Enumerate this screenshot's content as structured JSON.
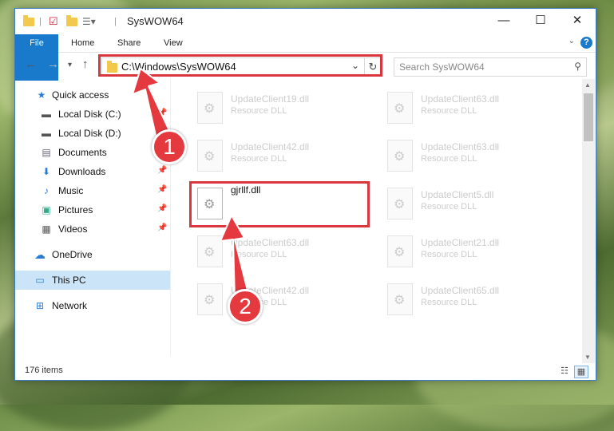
{
  "window": {
    "title": "SysWOW64",
    "controls": {
      "minimize": "—",
      "maximize": "☐",
      "close": "✕"
    }
  },
  "ribbon": {
    "tabs": [
      "File",
      "Home",
      "Share",
      "View"
    ],
    "help": "?"
  },
  "address": {
    "path": "C:\\Windows\\SysWOW64",
    "search_placeholder": "Search SysWOW64"
  },
  "nav_pane": {
    "items": [
      {
        "label": "Quick access",
        "icon": "star-icon"
      },
      {
        "label": "Local Disk (C:)",
        "icon": "drive-icon"
      },
      {
        "label": "Local Disk (D:)",
        "icon": "drive-icon"
      },
      {
        "label": "Documents",
        "icon": "documents-icon"
      },
      {
        "label": "Downloads",
        "icon": "downloads-icon"
      },
      {
        "label": "Music",
        "icon": "music-icon"
      },
      {
        "label": "Pictures",
        "icon": "pictures-icon"
      },
      {
        "label": "Videos",
        "icon": "videos-icon"
      },
      {
        "label": "OneDrive",
        "icon": "cloud-icon"
      },
      {
        "label": "This PC",
        "icon": "computer-icon"
      },
      {
        "label": "Network",
        "icon": "network-icon"
      }
    ]
  },
  "files": [
    {
      "name": "UpdateClient19.dll",
      "type": "Resource DLL"
    },
    {
      "name": "UpdateClient63.dll",
      "type": "Resource DLL"
    },
    {
      "name": "UpdateClient42.dll",
      "type": "Resource DLL"
    },
    {
      "name": "UpdateClient63.dll",
      "type": "Resource DLL"
    },
    {
      "name": "gjrllf.dll",
      "type": ""
    },
    {
      "name": "UpdateClient5.dll",
      "type": "Resource DLL"
    },
    {
      "name": "UpdateClient63.dll",
      "type": "Resource DLL"
    },
    {
      "name": "UpdateClient21.dll",
      "type": "Resource DLL"
    },
    {
      "name": "UpdateClient42.dll",
      "type": "Resource DLL"
    },
    {
      "name": "UpdateClient65.dll",
      "type": "Resource DLL"
    }
  ],
  "status": {
    "item_count": "176 items"
  },
  "annotations": {
    "callout_1": "1",
    "callout_2": "2"
  },
  "colors": {
    "accent": "#1979ca",
    "highlight": "#d9363e",
    "selected": "#cce4f7"
  }
}
